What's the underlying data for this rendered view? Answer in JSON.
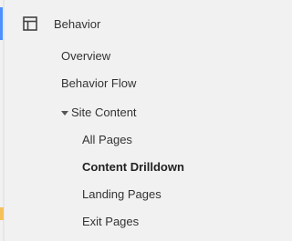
{
  "nav": {
    "section": {
      "label": "Behavior",
      "icon": "layout-grid-icon"
    },
    "items": [
      {
        "label": "Overview"
      },
      {
        "label": "Behavior Flow"
      }
    ],
    "group": {
      "label": "Site Content",
      "expanded": true,
      "children": [
        {
          "label": "All Pages",
          "active": false
        },
        {
          "label": "Content Drilldown",
          "active": true
        },
        {
          "label": "Landing Pages",
          "active": false
        },
        {
          "label": "Exit Pages",
          "active": false
        }
      ]
    }
  },
  "colors": {
    "accent": "#4d90fe",
    "background": "#f1f1f1",
    "text": "#333333"
  }
}
